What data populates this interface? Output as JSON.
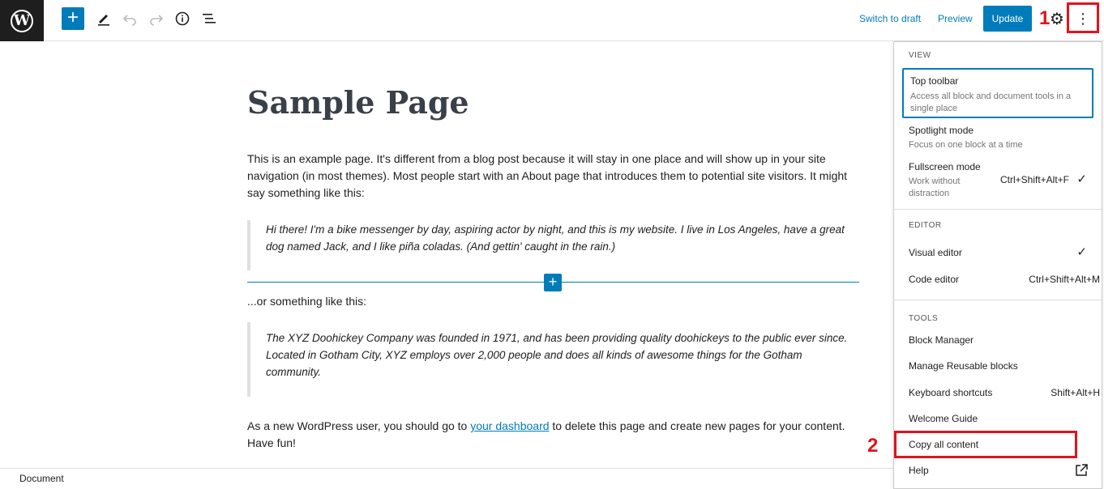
{
  "toolbar": {
    "add_symbol": "+",
    "switch_to_draft": "Switch to draft",
    "preview": "Preview",
    "update": "Update",
    "more_symbol": "⋮",
    "gear_symbol": "⚙"
  },
  "annotations": {
    "one": "1",
    "two": "2"
  },
  "content": {
    "title": "Sample Page",
    "intro": "This is an example page. It's different from a blog post because it will stay in one place and will show up in your site navigation (in most themes). Most people start with an About page that introduces them to potential site visitors. It might say something like this:",
    "quote1": "Hi there! I'm a bike messenger by day, aspiring actor by night, and this is my website. I live in Los Angeles, have a great dog named Jack, and I like piña coladas. (And gettin' caught in the rain.)",
    "middle": "...or something like this:",
    "quote2": "The XYZ Doohickey Company was founded in 1971, and has been providing quality doohickeys to the public ever since. Located in Gotham City, XYZ employs over 2,000 people and does all kinds of awesome things for the Gotham community.",
    "outro_before": "As a new WordPress user, you should go to ",
    "outro_link": "your dashboard",
    "outro_after": " to delete this page and create new pages for your content. Have fun!"
  },
  "footer": {
    "breadcrumb": "Document"
  },
  "menu": {
    "view_title": "VIEW",
    "top_toolbar": {
      "label": "Top toolbar",
      "help": "Access all block and document tools in a single place"
    },
    "spotlight": {
      "label": "Spotlight mode",
      "help": "Focus on one block at a time"
    },
    "fullscreen": {
      "label": "Fullscreen mode",
      "help": "Work without distraction",
      "shortcut": "Ctrl+Shift+Alt+F",
      "check": "✓"
    },
    "editor_title": "EDITOR",
    "visual": {
      "label": "Visual editor",
      "check": "✓"
    },
    "code": {
      "label": "Code editor",
      "shortcut": "Ctrl+Shift+Alt+M"
    },
    "tools_title": "TOOLS",
    "block_manager": "Block Manager",
    "reusable": "Manage Reusable blocks",
    "shortcuts": {
      "label": "Keyboard shortcuts",
      "shortcut": "Shift+Alt+H"
    },
    "welcome": "Welcome Guide",
    "copy_all": "Copy all content",
    "help": "Help"
  }
}
